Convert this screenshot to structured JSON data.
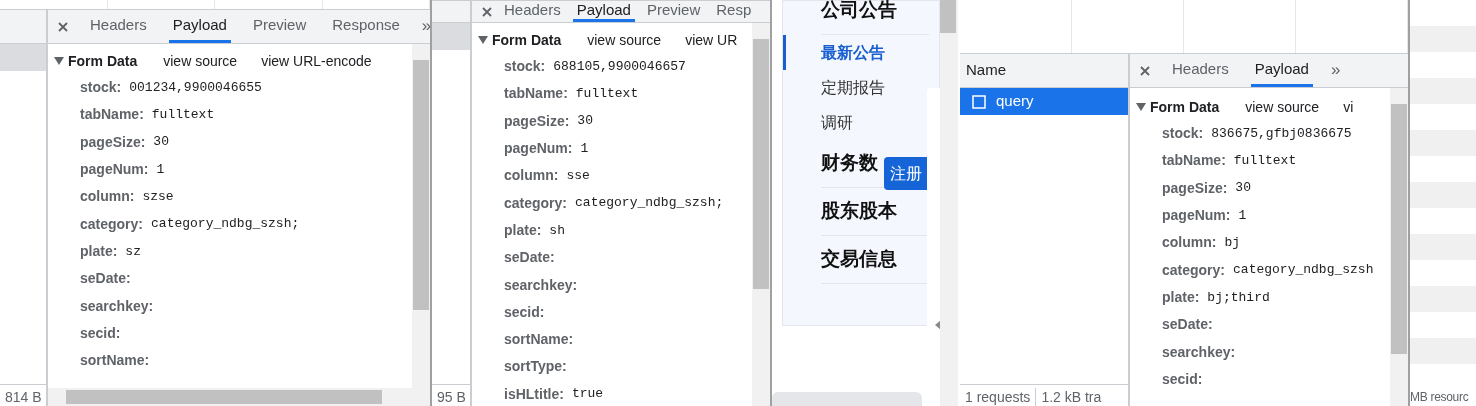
{
  "devtools_panes": [
    {
      "network": {
        "selected_row": true,
        "status": [
          "814 B"
        ]
      },
      "tabs": [
        {
          "label": "Headers",
          "selected": false
        },
        {
          "label": "Payload",
          "selected": true
        },
        {
          "label": "Preview",
          "selected": false
        },
        {
          "label": "Response",
          "selected": false
        }
      ],
      "more_tabs": "»",
      "form": {
        "title": "Form Data",
        "expanded": true,
        "links": [
          "view source",
          "view URL-encode"
        ],
        "fields": [
          {
            "key": "stock:",
            "value": "001234,9900046655"
          },
          {
            "key": "tabName:",
            "value": "fulltext"
          },
          {
            "key": "pageSize:",
            "value": "30"
          },
          {
            "key": "pageNum:",
            "value": "1"
          },
          {
            "key": "column:",
            "value": "szse"
          },
          {
            "key": "category:",
            "value": "category_ndbg_szsh;"
          },
          {
            "key": "plate:",
            "value": "sz"
          },
          {
            "key": "seDate:"
          },
          {
            "key": "searchkey:"
          },
          {
            "key": "secid:"
          },
          {
            "key": "sortName:"
          }
        ]
      }
    },
    {
      "network": {
        "selected_row": true,
        "status": [
          "95 B"
        ]
      },
      "tabs": [
        {
          "label": "Headers",
          "selected": false
        },
        {
          "label": "Payload",
          "selected": true
        },
        {
          "label": "Preview",
          "selected": false
        },
        {
          "label": "Resp",
          "selected": false
        }
      ],
      "form": {
        "title": "Form Data",
        "expanded": true,
        "links": [
          "view source",
          "view UR"
        ],
        "fields": [
          {
            "key": "stock:",
            "value": "688105,9900046657"
          },
          {
            "key": "tabName:",
            "value": "fulltext"
          },
          {
            "key": "pageSize:",
            "value": "30"
          },
          {
            "key": "pageNum:",
            "value": "1"
          },
          {
            "key": "column:",
            "value": "sse"
          },
          {
            "key": "category:",
            "value": "category_ndbg_szsh;"
          },
          {
            "key": "plate:",
            "value": "sh"
          },
          {
            "key": "seDate:"
          },
          {
            "key": "searchkey:"
          },
          {
            "key": "secid:"
          },
          {
            "key": "sortName:"
          },
          {
            "key": "sortType:"
          },
          {
            "key": "isHLtitle:",
            "value": "true"
          }
        ]
      }
    },
    {
      "network": {
        "column_header": "Name",
        "requests": [
          {
            "name": "query",
            "selected": true
          }
        ],
        "status": [
          "1 requests",
          "1.2 kB tra"
        ]
      },
      "tabs": [
        {
          "label": "Headers",
          "selected": false
        },
        {
          "label": "Payload",
          "selected": true
        }
      ],
      "more_tabs": "»",
      "form": {
        "title": "Form Data",
        "expanded": true,
        "links": [
          "view source",
          "vi"
        ],
        "fields": [
          {
            "key": "stock:",
            "value": "836675,gfbj0836675"
          },
          {
            "key": "tabName:",
            "value": "fulltext"
          },
          {
            "key": "pageSize:",
            "value": "30"
          },
          {
            "key": "pageNum:",
            "value": "1"
          },
          {
            "key": "column:",
            "value": "bj"
          },
          {
            "key": "category:",
            "value": "category_ndbg_szsh"
          },
          {
            "key": "plate:",
            "value": "bj;third"
          },
          {
            "key": "seDate:"
          },
          {
            "key": "searchkey:"
          },
          {
            "key": "secid:"
          }
        ]
      }
    }
  ],
  "site_sidebar": {
    "items": [
      {
        "label": "公司公告",
        "kind": "heading",
        "selected": false
      },
      {
        "label": "最新公告",
        "kind": "link",
        "selected": true
      },
      {
        "label": "定期报告",
        "kind": "link",
        "selected": false
      },
      {
        "label": "调研",
        "kind": "link",
        "selected": false
      },
      {
        "label": "财务数",
        "kind": "heading",
        "selected": false
      },
      {
        "label": "股东股本",
        "kind": "heading",
        "selected": false
      },
      {
        "label": "交易信息",
        "kind": "heading",
        "selected": false
      }
    ],
    "register_button": "注册"
  },
  "right_status": "MB resourc"
}
